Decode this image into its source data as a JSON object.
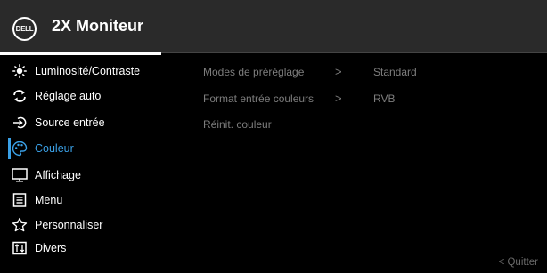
{
  "header": {
    "logo_text": "DELL",
    "title": "2X Moniteur"
  },
  "menu": {
    "items": [
      {
        "label": "Luminosité/Contraste",
        "icon": "brightness-icon"
      },
      {
        "label": "Réglage auto",
        "icon": "auto-adjust-icon"
      },
      {
        "label": "Source entrée",
        "icon": "input-source-icon"
      },
      {
        "label": "Couleur",
        "icon": "palette-icon",
        "active": true
      },
      {
        "label": "Affichage",
        "icon": "display-icon"
      },
      {
        "label": "Menu",
        "icon": "menu-list-icon"
      },
      {
        "label": "Personnaliser",
        "icon": "star-icon"
      },
      {
        "label": "Divers",
        "icon": "misc-icon"
      }
    ]
  },
  "submenu": {
    "rows": [
      {
        "label": "Modes de préréglage",
        "arrow": ">",
        "value": "Standard"
      },
      {
        "label": "Format entrée couleurs",
        "arrow": ">",
        "value": "RVB"
      },
      {
        "label": "Réinit. couleur"
      }
    ]
  },
  "footer": {
    "quit_label": "< Quitter"
  },
  "colors": {
    "accent": "#3aa0e6",
    "header_bg": "#2a2a2a",
    "background": "#000000",
    "dim_text": "#7d7d7d"
  }
}
